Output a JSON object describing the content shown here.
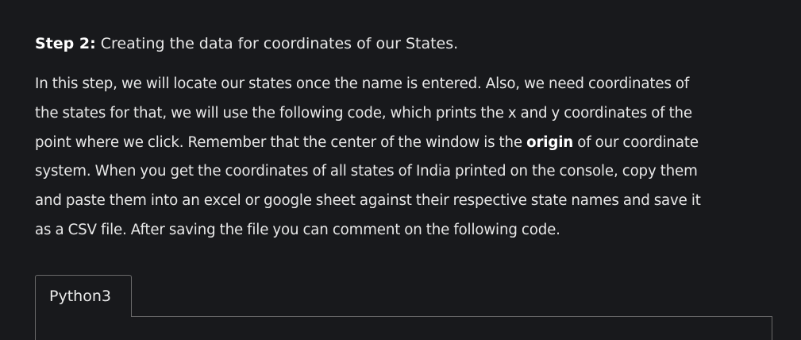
{
  "step": {
    "label": "Step 2:",
    "title": " Creating the data for coordinates of our States."
  },
  "paragraph": {
    "line1": "In this step, we will locate our states once the name is entered. Also, we need coordinates of",
    "line2": "the states for that, we will use the following code, which prints the x and y coordinates of the",
    "line3_before": "point where we click. Remember that the center of the window is the ",
    "line3_bold": "origin",
    "line3_after": " of our coordinate",
    "line4": "system. When you get the coordinates of all states of India printed on the console, copy them",
    "line5": "and paste them into an excel or google sheet against their respective state names and save it",
    "line6": "as a CSV file. After saving the file you can comment on the following code."
  },
  "code_tabs": [
    {
      "label": "Python3"
    }
  ]
}
